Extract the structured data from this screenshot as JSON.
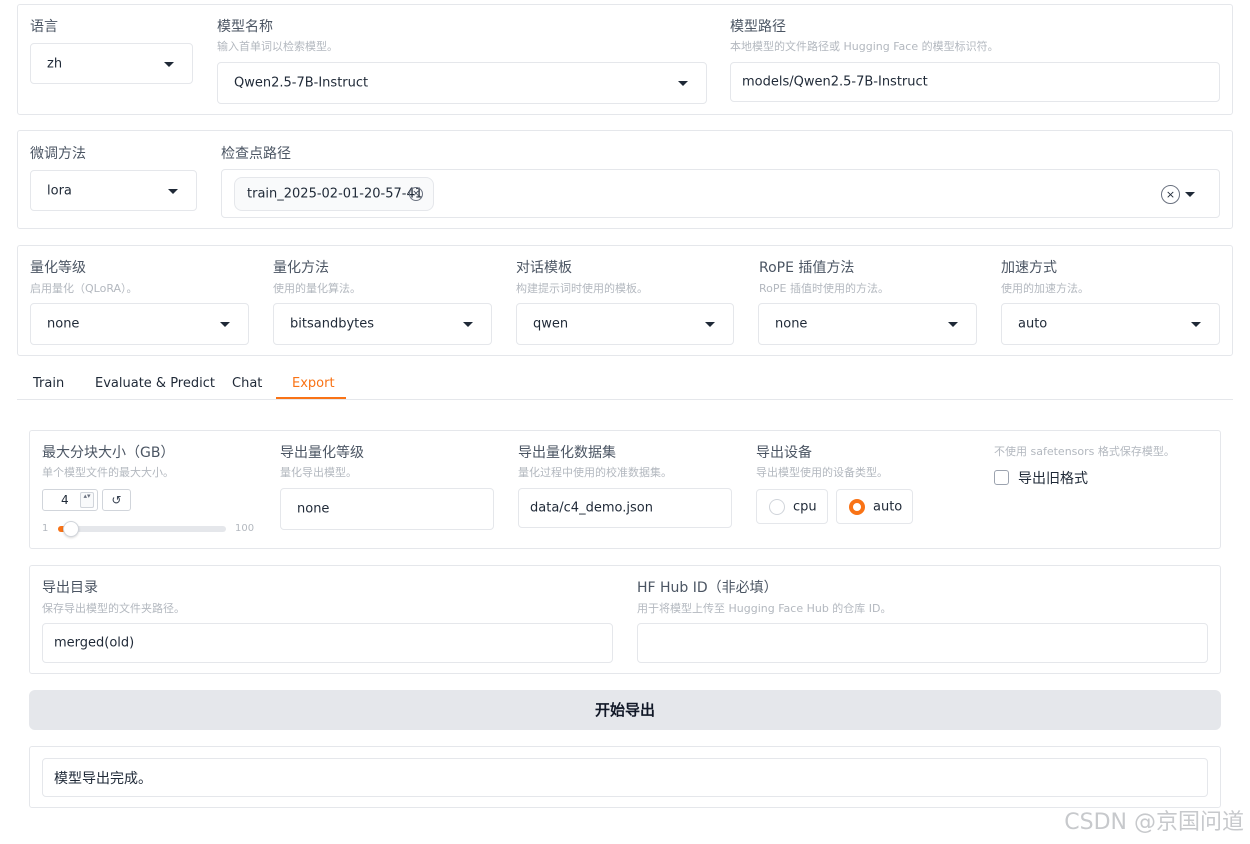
{
  "top": {
    "language": {
      "label": "语言",
      "value": "zh"
    },
    "model_name": {
      "label": "模型名称",
      "info": "输入首单词以检索模型。",
      "value": "Qwen2.5-7B-Instruct"
    },
    "model_path": {
      "label": "模型路径",
      "info": "本地模型的文件路径或 Hugging Face 的模型标识符。",
      "value": "models/Qwen2.5-7B-Instruct"
    }
  },
  "finetune": {
    "method": {
      "label": "微调方法",
      "value": "lora"
    },
    "checkpoint": {
      "label": "检查点路径",
      "chip": "train_2025-02-01-20-57-41",
      "chip_remove": "×",
      "clear": "×"
    }
  },
  "advanced": {
    "quant_bit": {
      "label": "量化等级",
      "info": "启用量化（QLoRA）。",
      "value": "none"
    },
    "quant_method": {
      "label": "量化方法",
      "info": "使用的量化算法。",
      "value": "bitsandbytes"
    },
    "template": {
      "label": "对话模板",
      "info": "构建提示词时使用的模板。",
      "value": "qwen"
    },
    "rope": {
      "label": "RoPE 插值方法",
      "info": "RoPE 插值时使用的方法。",
      "value": "none"
    },
    "booster": {
      "label": "加速方式",
      "info": "使用的加速方法。",
      "value": "auto"
    }
  },
  "tabs": [
    {
      "label": "Train"
    },
    {
      "label": "Evaluate & Predict"
    },
    {
      "label": "Chat"
    },
    {
      "label": "Export"
    }
  ],
  "active_tab": "Export",
  "export": {
    "max_shard": {
      "label": "最大分块大小（GB）",
      "info": "单个模型文件的最大大小。",
      "value": "4",
      "min": "1",
      "max": "100",
      "fraction": 0.03,
      "reset": "↺",
      "spin": "▴▾"
    },
    "quant_bit": {
      "label": "导出量化等级",
      "info": "量化导出模型。",
      "value": "none"
    },
    "quant_dataset": {
      "label": "导出量化数据集",
      "info": "量化过程中使用的校准数据集。",
      "value": "data/c4_demo.json"
    },
    "device": {
      "label": "导出设备",
      "info": "导出模型使用的设备类型。",
      "options": [
        "cpu",
        "auto"
      ],
      "selected": "auto"
    },
    "legacy": {
      "info": "不使用 safetensors 格式保存模型。",
      "label": "导出旧格式",
      "checked": false
    },
    "dir": {
      "label": "导出目录",
      "info": "保存导出模型的文件夹路径。",
      "value": "merged(old)"
    },
    "hub": {
      "label": "HF Hub ID（非必填）",
      "info": "用于将模型上传至 Hugging Face Hub 的仓库 ID。",
      "value": ""
    },
    "button": "开始导出",
    "output": "模型导出完成。"
  },
  "watermark": "CSDN @京国问道",
  "colors": {
    "accent": "#f97316",
    "border": "#e5e7eb",
    "button_bg": "#e5e7eb"
  }
}
